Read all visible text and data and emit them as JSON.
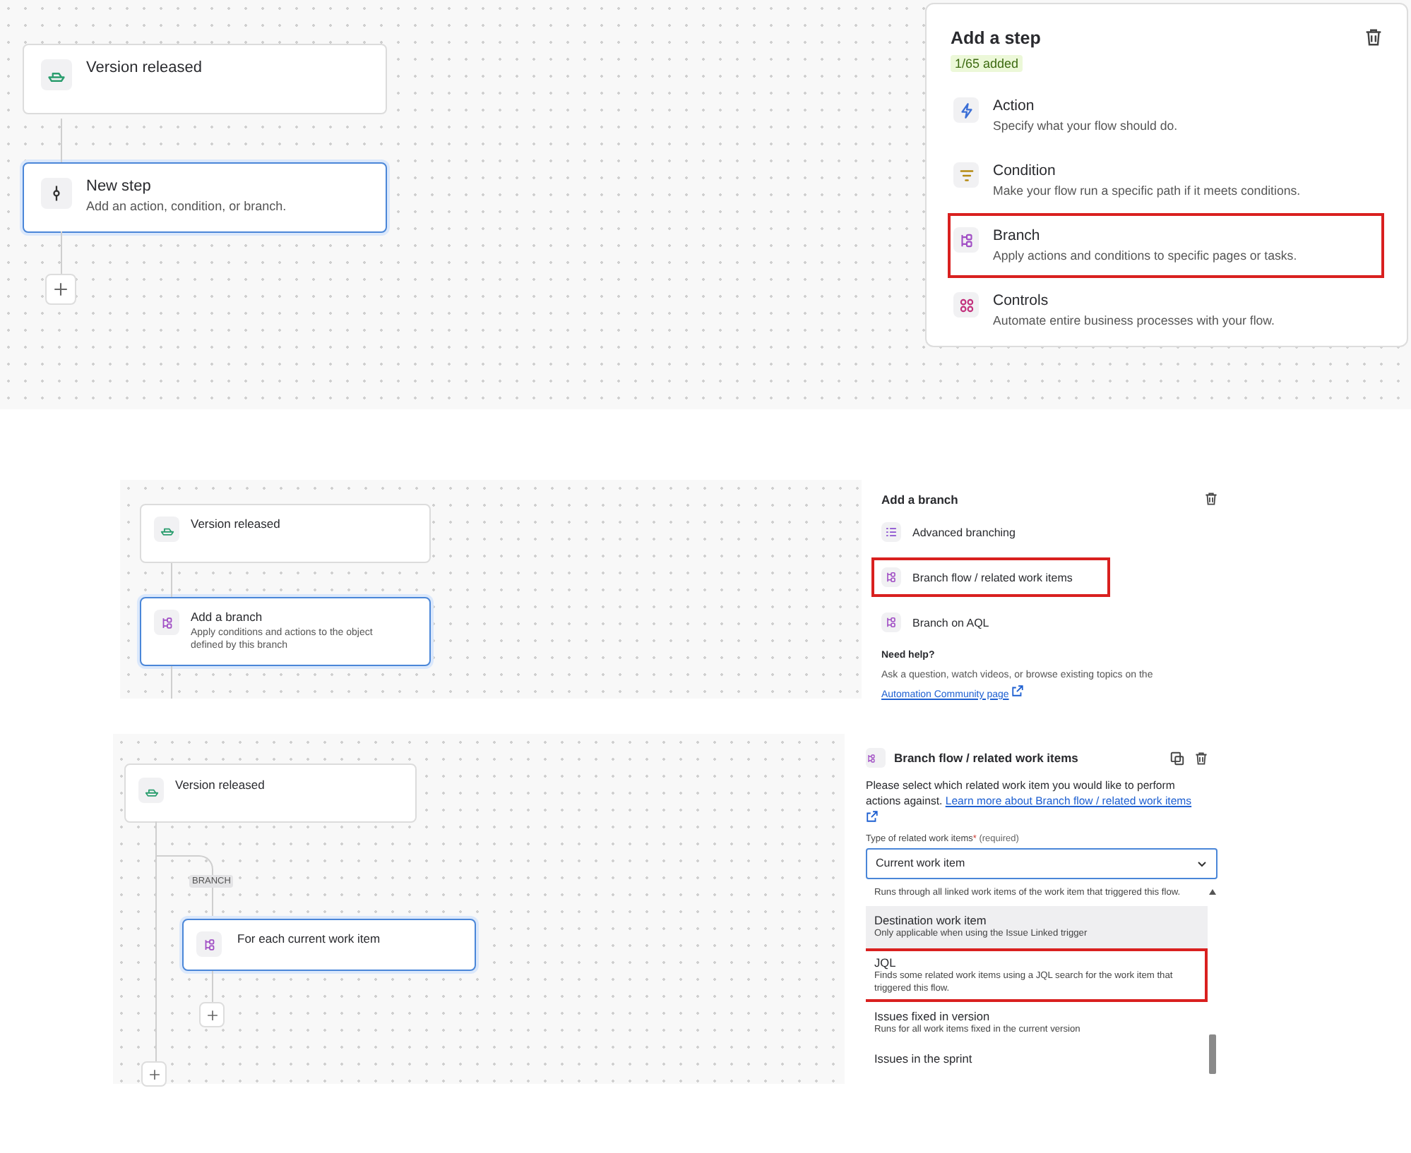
{
  "step_screen": {
    "nodes": [
      {
        "kind": "trigger",
        "title": "Version released",
        "selected": false
      },
      {
        "kind": "step",
        "title": "New step",
        "subtitle": "Add an action, condition, or branch.",
        "selected": true
      }
    ],
    "panel": {
      "title": "Add a step",
      "badge": "1/65 added",
      "options": [
        {
          "kind": "action",
          "title": "Action",
          "description": "Specify what your flow should do.",
          "highlighted": false
        },
        {
          "kind": "condition",
          "title": "Condition",
          "description": "Make your flow run a specific path if it meets conditions.",
          "highlighted": false
        },
        {
          "kind": "branch",
          "title": "Branch",
          "description": "Apply actions and conditions to specific pages or tasks.",
          "highlighted": true
        },
        {
          "kind": "controls",
          "title": "Controls",
          "description": "Automate entire business processes with your flow.",
          "highlighted": false
        }
      ]
    }
  },
  "branch_screen": {
    "nodes": [
      {
        "kind": "trigger",
        "title": "Version released",
        "selected": false
      },
      {
        "kind": "branch",
        "title": "Add a branch",
        "subtitle": "Apply conditions and actions to the object defined by this branch",
        "selected": true
      }
    ],
    "panel": {
      "title": "Add a branch",
      "options": [
        {
          "kind": "list",
          "title": "Advanced branching",
          "highlighted": false
        },
        {
          "kind": "branch",
          "title": "Branch flow / related work items",
          "highlighted": true
        },
        {
          "kind": "branch",
          "title": "Branch on AQL",
          "highlighted": false
        }
      ],
      "help_title": "Need help?",
      "help_text": "Ask a question, watch videos, or browse existing topics on the",
      "help_link": "Automation Community page"
    }
  },
  "related_screen": {
    "trigger": {
      "title": "Version released"
    },
    "branch_tag": "BRANCH",
    "branch_node": {
      "title": "For each current work item",
      "selected": true
    },
    "panel": {
      "title": "Branch flow / related work items",
      "description": "Please select which related work item you would like to perform actions against.",
      "link": "Learn more about Branch flow / related work items",
      "field_label": "Type of related work items",
      "required_mark": "*",
      "required_hint": "(required)",
      "field_value": "Current work item",
      "options": [
        {
          "description": "Runs through all linked work items of the work item that triggered this flow.",
          "selected": false,
          "highlighted": false
        },
        {
          "title": "Destination work item",
          "description": "Only applicable when using the Issue Linked trigger",
          "selected": true,
          "highlighted": false
        },
        {
          "title": "JQL",
          "description": "Finds some related work items using a JQL search for the work item that triggered this flow.",
          "selected": false,
          "highlighted": true
        },
        {
          "title": "Issues fixed in version",
          "description": "Runs for all work items fixed in the current version",
          "selected": false,
          "highlighted": false
        },
        {
          "title": "Issues in the sprint",
          "selected": false,
          "highlighted": false
        }
      ]
    }
  }
}
